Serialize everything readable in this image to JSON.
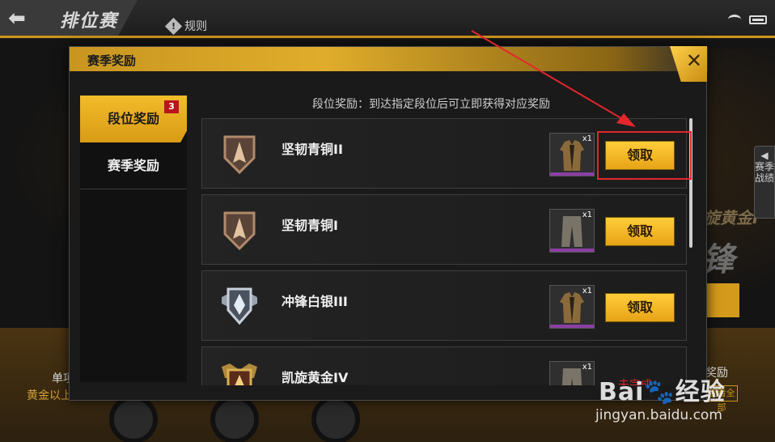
{
  "header": {
    "back_icon": "back-arrow-icon",
    "title": "排位赛",
    "rules_label": "规则",
    "rules_icon_glyph": "!"
  },
  "background": {
    "season_card_label": "凯旋黄金I",
    "season_big_text": "锋",
    "right_rail_label": "赛季战绩",
    "bottom_reward_label": "奖励",
    "bottom_view_label": "查看全部",
    "bottom_item_label": "单项",
    "bottom_item_sub": "黄金以上"
  },
  "modal": {
    "title": "赛季奖励",
    "close_glyph": "✕",
    "description": "段位奖励：到达指定段位后可立即获得对应奖励",
    "tabs": [
      {
        "label": "段位奖励",
        "active": true,
        "badge": "3"
      },
      {
        "label": "赛季奖励",
        "active": false,
        "badge": ""
      }
    ],
    "rows": [
      {
        "rank": "坚韧青铜II",
        "tier": "bronze",
        "item": "jacket",
        "qty": "x1",
        "action": "领取",
        "status": ""
      },
      {
        "rank": "坚韧青铜I",
        "tier": "bronze",
        "item": "pants",
        "qty": "x1",
        "action": "领取",
        "status": ""
      },
      {
        "rank": "冲锋白银III",
        "tier": "silver",
        "item": "jacket",
        "qty": "x1",
        "action": "领取",
        "status": ""
      },
      {
        "rank": "凯旋黄金IV",
        "tier": "gold",
        "item": "pants",
        "qty": "x1",
        "action": "",
        "status": "未完成"
      }
    ]
  },
  "watermark": {
    "logo_text": "Bai",
    "logo_text2": "经验",
    "url": "jingyan.baidu.com"
  },
  "colors": {
    "accent_gold": "#e0ad2b",
    "annotation_red": "#e3262c",
    "badge_red": "#b8161a",
    "rarity_purple": "#8b3fa3"
  }
}
